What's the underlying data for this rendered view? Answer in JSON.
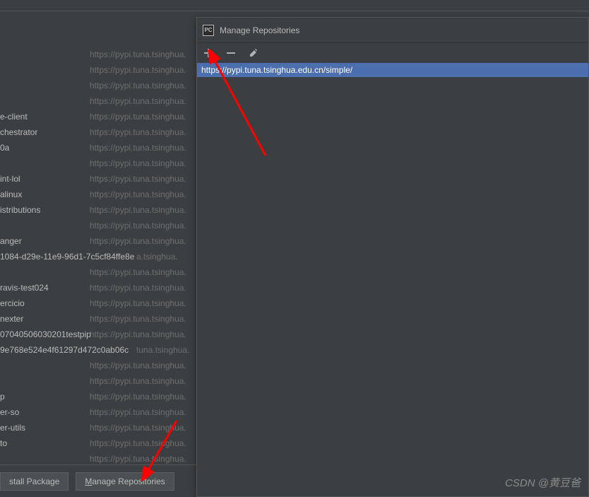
{
  "packages": [
    {
      "name": "",
      "source": "https://pypi.tuna.tsinghua."
    },
    {
      "name": "",
      "source": "https://pypi.tuna.tsinghua."
    },
    {
      "name": "",
      "source": "https://pypi.tuna.tsinghua."
    },
    {
      "name": "",
      "source": "https://pypi.tuna.tsinghua."
    },
    {
      "name": "e-client",
      "source": "https://pypi.tuna.tsinghua."
    },
    {
      "name": "chestrator",
      "source": "https://pypi.tuna.tsinghua."
    },
    {
      "name": "0a",
      "source": "https://pypi.tuna.tsinghua."
    },
    {
      "name": "",
      "source": "https://pypi.tuna.tsinghua."
    },
    {
      "name": "int-lol",
      "source": "https://pypi.tuna.tsinghua."
    },
    {
      "name": "alinux",
      "source": "https://pypi.tuna.tsinghua."
    },
    {
      "name": "istributions",
      "source": "https://pypi.tuna.tsinghua."
    },
    {
      "name": "",
      "source": "https://pypi.tuna.tsinghua."
    },
    {
      "name": "anger",
      "source": "https://pypi.tuna.tsinghua."
    },
    {
      "name": "1084-d29e-11e9-96d1-7c5cf84ffe8e",
      "source": "a.tsinghua.",
      "shifted": true
    },
    {
      "name": "",
      "source": "https://pypi.tuna.tsinghua."
    },
    {
      "name": "ravis-test024",
      "source": "https://pypi.tuna.tsinghua."
    },
    {
      "name": "ercicio",
      "source": "https://pypi.tuna.tsinghua."
    },
    {
      "name": "nexter",
      "source": "https://pypi.tuna.tsinghua."
    },
    {
      "name": "07040506030201testpip",
      "source": "https://pypi.tuna.tsinghua."
    },
    {
      "name": "9e768e524e4f61297d472c0ab06c",
      "source": "tuna.tsinghua.",
      "shifted": true
    },
    {
      "name": "",
      "source": "https://pypi.tuna.tsinghua."
    },
    {
      "name": "",
      "source": "https://pypi.tuna.tsinghua."
    },
    {
      "name": "p",
      "source": "https://pypi.tuna.tsinghua."
    },
    {
      "name": "er-so",
      "source": "https://pypi.tuna.tsinghua."
    },
    {
      "name": "er-utils",
      "source": "https://pypi.tuna.tsinghua."
    },
    {
      "name": "to",
      "source": "https://pypi.tuna.tsinghua."
    },
    {
      "name": "",
      "source": "https://pypi.tuna.tsinghua."
    }
  ],
  "buttons": {
    "install": "stall Package",
    "manage_prefix": "M",
    "manage_rest": "anage Repositories"
  },
  "dialog": {
    "icon": "PC",
    "title": "Manage Repositories",
    "repo_url": "https://pypi.tuna.tsinghua.edu.cn/simple/"
  },
  "watermark": "CSDN @黄豆爸"
}
